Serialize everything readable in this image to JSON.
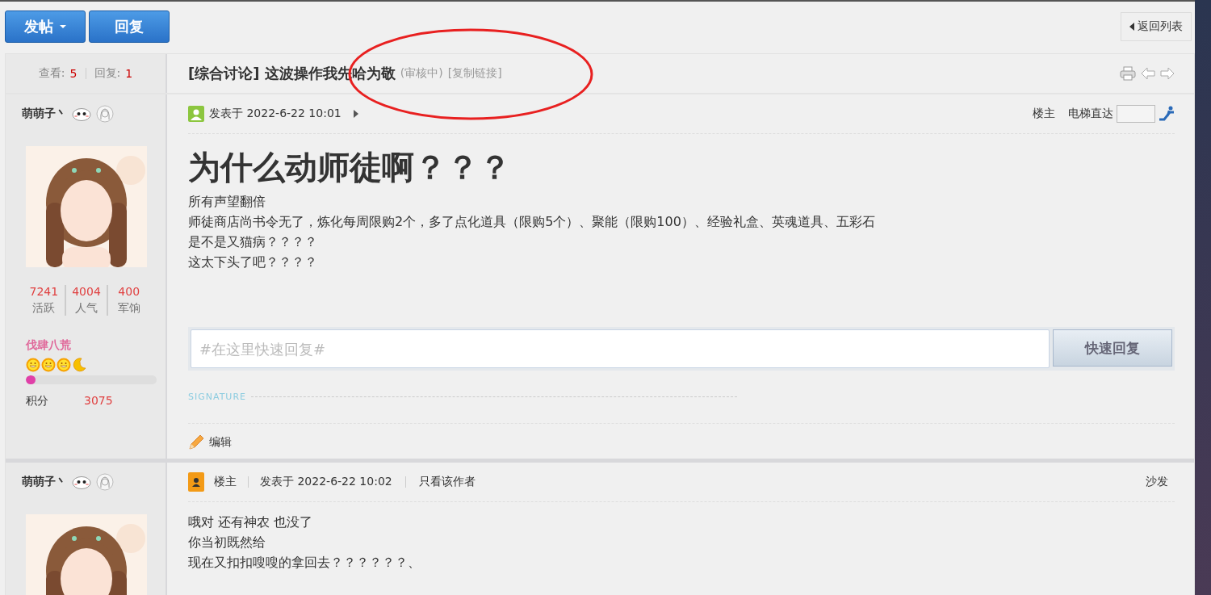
{
  "toolbar": {
    "buttons": [
      {
        "label": "发帖",
        "dropdown": true
      },
      {
        "label": "回复",
        "dropdown": false
      }
    ],
    "back_link": "返回列表"
  },
  "thread": {
    "stats": [
      {
        "label": "查看:",
        "value": "5"
      },
      {
        "label": "回复:",
        "value": "1"
      }
    ],
    "category": "[综合讨论]",
    "title": "这波操作我先哈为敬",
    "status": "(审核中)",
    "copy_link": "[复制链接]"
  },
  "posts": [
    {
      "author": "萌萌子丶",
      "profile": {
        "stats": [
          {
            "value": "7241",
            "label": "活跃"
          },
          {
            "value": "4004",
            "label": "人气"
          },
          {
            "value": "400",
            "label": "军饷"
          }
        ],
        "rank": "伐肆八荒",
        "rank_icons": [
          {
            "kind": "sun"
          },
          {
            "kind": "sun"
          },
          {
            "kind": "sun"
          },
          {
            "kind": "moon"
          }
        ],
        "level": 0.07,
        "score_label": "积分",
        "score_value": "3075"
      },
      "meta": [
        {
          "kind": "user",
          "text": "发表于 2022-6-22 10:01"
        }
      ],
      "floor": "楼主",
      "jump_label": "电梯直达",
      "heading": "为什么动师徒啊？？？",
      "lines": [
        "所有声望翻倍",
        "师徒商店尚书令无了，炼化每周限购2个，多了点化道具（限购5个）、聚能（限购100）、经验礼盒、英魂道具、五彩石",
        "是不是又猫病？？？？",
        "这太下头了吧？？？？"
      ],
      "quick_reply": {
        "placeholder": "#在这里快速回复#",
        "button": "快速回复"
      },
      "signature": "SIGNATURE",
      "edit": "编辑"
    },
    {
      "author": "萌萌子丶",
      "meta": [
        {
          "kind": "badge",
          "text": "楼主"
        },
        {
          "kind": "plain",
          "text": "发表于 2022-6-22 10:02"
        },
        {
          "kind": "link",
          "text": "只看该作者"
        }
      ],
      "floor": "沙发",
      "lines": [
        "哦对 还有神农 也没了",
        "你当初既然给",
        "现在又扣扣嗖嗖的拿回去？？？？？？、"
      ]
    }
  ]
}
